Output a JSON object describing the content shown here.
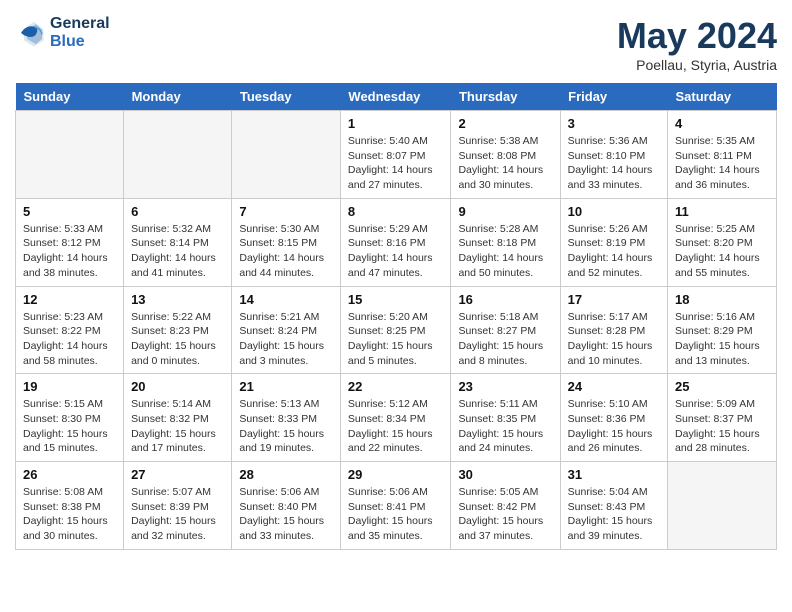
{
  "header": {
    "logo_line1": "General",
    "logo_line2": "Blue",
    "month": "May 2024",
    "location": "Poellau, Styria, Austria"
  },
  "days_of_week": [
    "Sunday",
    "Monday",
    "Tuesday",
    "Wednesday",
    "Thursday",
    "Friday",
    "Saturday"
  ],
  "weeks": [
    [
      {
        "day": "",
        "sunrise": "",
        "sunset": "",
        "daylight": "",
        "empty": true
      },
      {
        "day": "",
        "sunrise": "",
        "sunset": "",
        "daylight": "",
        "empty": true
      },
      {
        "day": "",
        "sunrise": "",
        "sunset": "",
        "daylight": "",
        "empty": true
      },
      {
        "day": "1",
        "sunrise": "Sunrise: 5:40 AM",
        "sunset": "Sunset: 8:07 PM",
        "daylight": "Daylight: 14 hours and 27 minutes."
      },
      {
        "day": "2",
        "sunrise": "Sunrise: 5:38 AM",
        "sunset": "Sunset: 8:08 PM",
        "daylight": "Daylight: 14 hours and 30 minutes."
      },
      {
        "day": "3",
        "sunrise": "Sunrise: 5:36 AM",
        "sunset": "Sunset: 8:10 PM",
        "daylight": "Daylight: 14 hours and 33 minutes."
      },
      {
        "day": "4",
        "sunrise": "Sunrise: 5:35 AM",
        "sunset": "Sunset: 8:11 PM",
        "daylight": "Daylight: 14 hours and 36 minutes."
      }
    ],
    [
      {
        "day": "5",
        "sunrise": "Sunrise: 5:33 AM",
        "sunset": "Sunset: 8:12 PM",
        "daylight": "Daylight: 14 hours and 38 minutes."
      },
      {
        "day": "6",
        "sunrise": "Sunrise: 5:32 AM",
        "sunset": "Sunset: 8:14 PM",
        "daylight": "Daylight: 14 hours and 41 minutes."
      },
      {
        "day": "7",
        "sunrise": "Sunrise: 5:30 AM",
        "sunset": "Sunset: 8:15 PM",
        "daylight": "Daylight: 14 hours and 44 minutes."
      },
      {
        "day": "8",
        "sunrise": "Sunrise: 5:29 AM",
        "sunset": "Sunset: 8:16 PM",
        "daylight": "Daylight: 14 hours and 47 minutes."
      },
      {
        "day": "9",
        "sunrise": "Sunrise: 5:28 AM",
        "sunset": "Sunset: 8:18 PM",
        "daylight": "Daylight: 14 hours and 50 minutes."
      },
      {
        "day": "10",
        "sunrise": "Sunrise: 5:26 AM",
        "sunset": "Sunset: 8:19 PM",
        "daylight": "Daylight: 14 hours and 52 minutes."
      },
      {
        "day": "11",
        "sunrise": "Sunrise: 5:25 AM",
        "sunset": "Sunset: 8:20 PM",
        "daylight": "Daylight: 14 hours and 55 minutes."
      }
    ],
    [
      {
        "day": "12",
        "sunrise": "Sunrise: 5:23 AM",
        "sunset": "Sunset: 8:22 PM",
        "daylight": "Daylight: 14 hours and 58 minutes."
      },
      {
        "day": "13",
        "sunrise": "Sunrise: 5:22 AM",
        "sunset": "Sunset: 8:23 PM",
        "daylight": "Daylight: 15 hours and 0 minutes."
      },
      {
        "day": "14",
        "sunrise": "Sunrise: 5:21 AM",
        "sunset": "Sunset: 8:24 PM",
        "daylight": "Daylight: 15 hours and 3 minutes."
      },
      {
        "day": "15",
        "sunrise": "Sunrise: 5:20 AM",
        "sunset": "Sunset: 8:25 PM",
        "daylight": "Daylight: 15 hours and 5 minutes."
      },
      {
        "day": "16",
        "sunrise": "Sunrise: 5:18 AM",
        "sunset": "Sunset: 8:27 PM",
        "daylight": "Daylight: 15 hours and 8 minutes."
      },
      {
        "day": "17",
        "sunrise": "Sunrise: 5:17 AM",
        "sunset": "Sunset: 8:28 PM",
        "daylight": "Daylight: 15 hours and 10 minutes."
      },
      {
        "day": "18",
        "sunrise": "Sunrise: 5:16 AM",
        "sunset": "Sunset: 8:29 PM",
        "daylight": "Daylight: 15 hours and 13 minutes."
      }
    ],
    [
      {
        "day": "19",
        "sunrise": "Sunrise: 5:15 AM",
        "sunset": "Sunset: 8:30 PM",
        "daylight": "Daylight: 15 hours and 15 minutes."
      },
      {
        "day": "20",
        "sunrise": "Sunrise: 5:14 AM",
        "sunset": "Sunset: 8:32 PM",
        "daylight": "Daylight: 15 hours and 17 minutes."
      },
      {
        "day": "21",
        "sunrise": "Sunrise: 5:13 AM",
        "sunset": "Sunset: 8:33 PM",
        "daylight": "Daylight: 15 hours and 19 minutes."
      },
      {
        "day": "22",
        "sunrise": "Sunrise: 5:12 AM",
        "sunset": "Sunset: 8:34 PM",
        "daylight": "Daylight: 15 hours and 22 minutes."
      },
      {
        "day": "23",
        "sunrise": "Sunrise: 5:11 AM",
        "sunset": "Sunset: 8:35 PM",
        "daylight": "Daylight: 15 hours and 24 minutes."
      },
      {
        "day": "24",
        "sunrise": "Sunrise: 5:10 AM",
        "sunset": "Sunset: 8:36 PM",
        "daylight": "Daylight: 15 hours and 26 minutes."
      },
      {
        "day": "25",
        "sunrise": "Sunrise: 5:09 AM",
        "sunset": "Sunset: 8:37 PM",
        "daylight": "Daylight: 15 hours and 28 minutes."
      }
    ],
    [
      {
        "day": "26",
        "sunrise": "Sunrise: 5:08 AM",
        "sunset": "Sunset: 8:38 PM",
        "daylight": "Daylight: 15 hours and 30 minutes."
      },
      {
        "day": "27",
        "sunrise": "Sunrise: 5:07 AM",
        "sunset": "Sunset: 8:39 PM",
        "daylight": "Daylight: 15 hours and 32 minutes."
      },
      {
        "day": "28",
        "sunrise": "Sunrise: 5:06 AM",
        "sunset": "Sunset: 8:40 PM",
        "daylight": "Daylight: 15 hours and 33 minutes."
      },
      {
        "day": "29",
        "sunrise": "Sunrise: 5:06 AM",
        "sunset": "Sunset: 8:41 PM",
        "daylight": "Daylight: 15 hours and 35 minutes."
      },
      {
        "day": "30",
        "sunrise": "Sunrise: 5:05 AM",
        "sunset": "Sunset: 8:42 PM",
        "daylight": "Daylight: 15 hours and 37 minutes."
      },
      {
        "day": "31",
        "sunrise": "Sunrise: 5:04 AM",
        "sunset": "Sunset: 8:43 PM",
        "daylight": "Daylight: 15 hours and 39 minutes."
      },
      {
        "day": "",
        "sunrise": "",
        "sunset": "",
        "daylight": "",
        "empty": true
      }
    ]
  ]
}
